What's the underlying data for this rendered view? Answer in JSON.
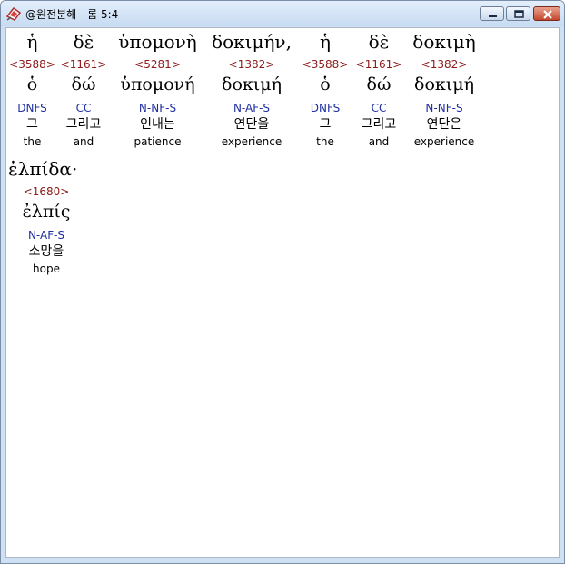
{
  "window": {
    "title": "@원전분해 - 롬 5:4"
  },
  "icons": {
    "app": "app-logo-icon",
    "minimize": "minimize-icon",
    "maximize": "maximize-icon",
    "close": "close-icon"
  },
  "colors": {
    "strong": "#8b1a1a",
    "parsing": "#1f2fa0",
    "titlebar": "#c6dbf2"
  },
  "verse": {
    "words": [
      {
        "greek": "ἡ",
        "strong": "<3588>",
        "lemma": "ὁ",
        "parsing": "DNFS",
        "korean": "그",
        "english": "the"
      },
      {
        "greek": "δὲ",
        "strong": "<1161>",
        "lemma": "δώ",
        "parsing": "CC",
        "korean": "그리고",
        "english": "and"
      },
      {
        "greek": "ὑπομονὴ",
        "strong": "<5281>",
        "lemma": "ὑπομονή",
        "parsing": "N-NF-S",
        "korean": "인내는",
        "english": "patience"
      },
      {
        "greek": "δοκιμήν,",
        "strong": "<1382>",
        "lemma": "δοκιμή",
        "parsing": "N-AF-S",
        "korean": "연단을",
        "english": "experience"
      },
      {
        "greek": "ἡ",
        "strong": "<3588>",
        "lemma": "ὁ",
        "parsing": "DNFS",
        "korean": "그",
        "english": "the"
      },
      {
        "greek": "δὲ",
        "strong": "<1161>",
        "lemma": "δώ",
        "parsing": "CC",
        "korean": "그리고",
        "english": "and"
      },
      {
        "greek": "δοκιμὴ",
        "strong": "<1382>",
        "lemma": "δοκιμή",
        "parsing": "N-NF-S",
        "korean": "연단은",
        "english": "experience"
      },
      {
        "greek": "ἐλπίδα·",
        "strong": "<1680>",
        "lemma": "ἐλπίς",
        "parsing": "N-AF-S",
        "korean": "소망을",
        "english": "hope"
      }
    ]
  }
}
